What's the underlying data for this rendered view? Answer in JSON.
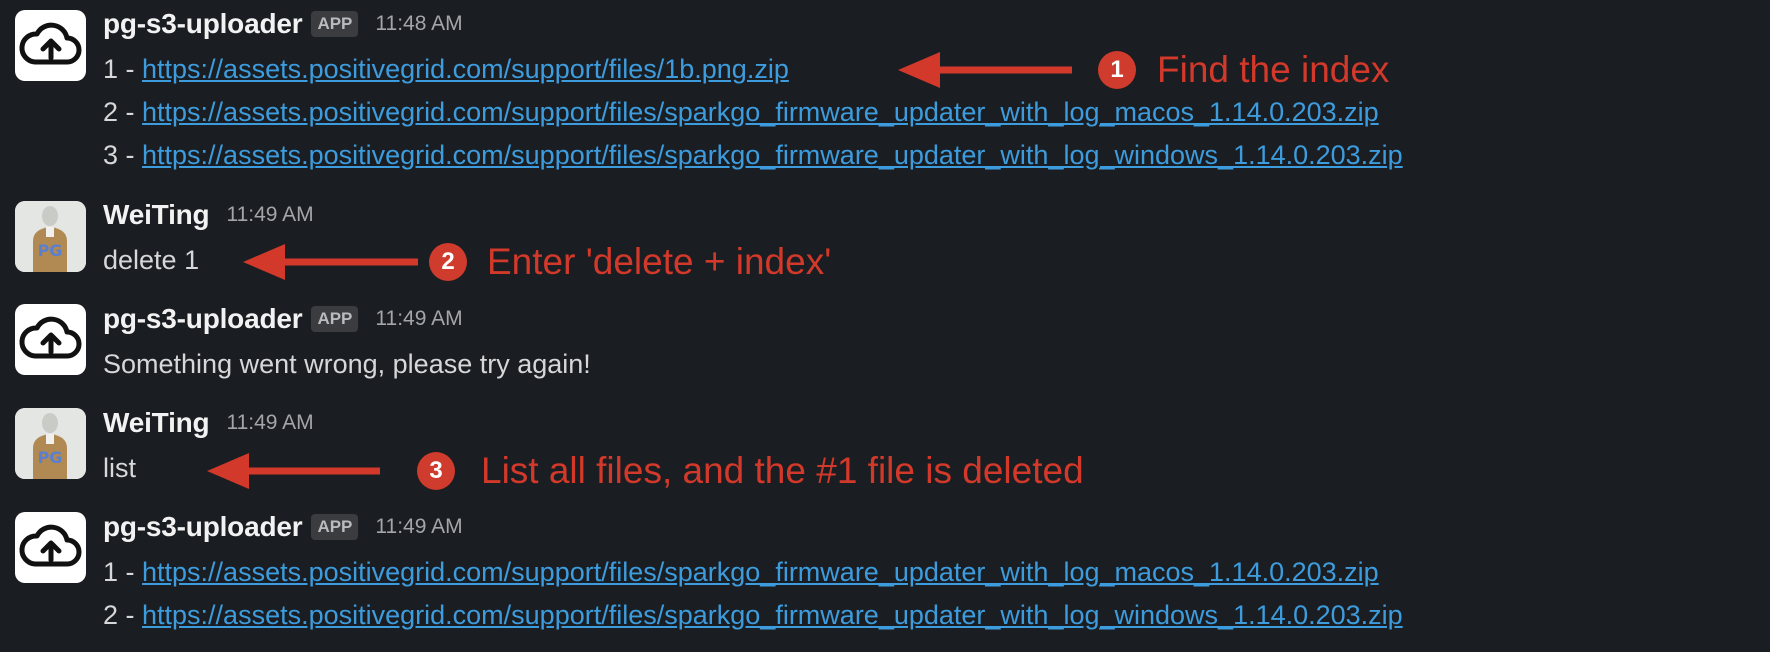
{
  "colors": {
    "background": "#1a1d21",
    "link": "#3d9cdd",
    "annotation": "#d2392a",
    "app_badge_bg": "#3a3c40"
  },
  "messages": [
    {
      "sender": "pg-s3-uploader",
      "badge": "APP",
      "time": "11:48 AM",
      "avatar_icon": "cloud-upload-icon",
      "lines": [
        {
          "prefix": "1 - ",
          "link": "https://assets.positivegrid.com/support/files/1b.png.zip"
        },
        {
          "prefix": "2 - ",
          "link": "https://assets.positivegrid.com/support/files/sparkgo_firmware_updater_with_log_macos_1.14.0.203.zip"
        },
        {
          "prefix": "3 - ",
          "link": "https://assets.positivegrid.com/support/files/sparkgo_firmware_updater_with_log_windows_1.14.0.203.zip"
        }
      ]
    },
    {
      "sender": "WeiTing",
      "time": "11:49 AM",
      "avatar_icon": "user-avatar-icon",
      "text": "delete 1"
    },
    {
      "sender": "pg-s3-uploader",
      "badge": "APP",
      "time": "11:49 AM",
      "avatar_icon": "cloud-upload-icon",
      "text": "Something went wrong, please try again!"
    },
    {
      "sender": "WeiTing",
      "time": "11:49 AM",
      "avatar_icon": "user-avatar-icon",
      "text": "list"
    },
    {
      "sender": "pg-s3-uploader",
      "badge": "APP",
      "time": "11:49 AM",
      "avatar_icon": "cloud-upload-icon",
      "lines": [
        {
          "prefix": "1 - ",
          "link": "https://assets.positivegrid.com/support/files/sparkgo_firmware_updater_with_log_macos_1.14.0.203.zip"
        },
        {
          "prefix": "2 - ",
          "link": "https://assets.positivegrid.com/support/files/sparkgo_firmware_updater_with_log_windows_1.14.0.203.zip"
        }
      ]
    }
  ],
  "annotations": [
    {
      "number": "1",
      "text": "Find the index"
    },
    {
      "number": "2",
      "text": "Enter 'delete + index'"
    },
    {
      "number": "3",
      "text": "List all files, and the #1 file is deleted"
    }
  ],
  "avatar_letters": "PG"
}
